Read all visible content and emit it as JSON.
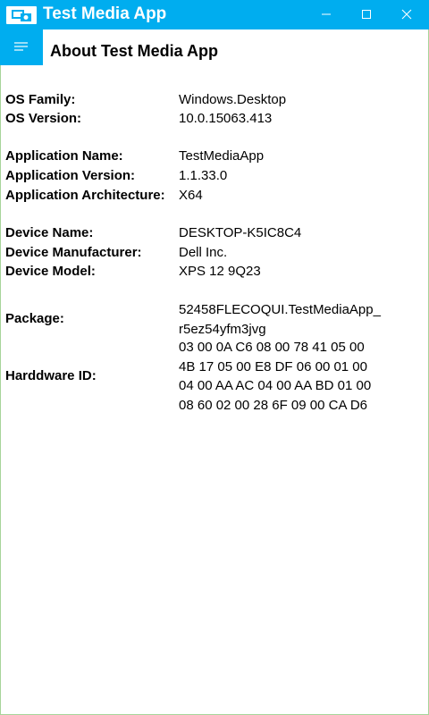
{
  "window": {
    "title": "Test Media App"
  },
  "header": {
    "title": "About Test Media App"
  },
  "info": {
    "os_family": {
      "label": "OS Family:",
      "value": "Windows.Desktop"
    },
    "os_version": {
      "label": "OS Version:",
      "value": "10.0.15063.413"
    },
    "app_name": {
      "label": "Application Name:",
      "value": "TestMediaApp"
    },
    "app_version": {
      "label": "Application Version:",
      "value": "1.1.33.0"
    },
    "app_arch": {
      "label": "Application Architecture:",
      "value": "X64"
    },
    "device_name": {
      "label": "Device Name:",
      "value": "DESKTOP-K5IC8C4"
    },
    "device_manufacturer": {
      "label": "Device Manufacturer:",
      "value": "Dell Inc."
    },
    "device_model": {
      "label": "Device Model:",
      "value": "XPS 12 9Q23"
    },
    "package": {
      "label": "Package:",
      "lines": [
        "52458FLECOQUI.TestMediaApp_",
        "r5ez54yfm3jvg"
      ]
    },
    "hardware_id": {
      "label": "Harddware ID:",
      "lines": [
        "03 00 0A C6 08 00 78 41 05 00",
        "4B 17 05 00 E8 DF 06 00 01 00",
        "04 00 AA AC 04 00 AA BD 01 00",
        "08 60 02 00 28 6F 09 00 CA D6"
      ]
    }
  },
  "icons": {
    "app": "app-logo-icon",
    "hamburger": "hamburger-menu-icon",
    "minimize": "minimize-icon",
    "maximize": "maximize-icon",
    "close": "close-icon"
  },
  "colors": {
    "accent": "#00adef",
    "frame_border": "#a7d49a",
    "title_text": "#ffffff",
    "content_text": "#000000"
  }
}
